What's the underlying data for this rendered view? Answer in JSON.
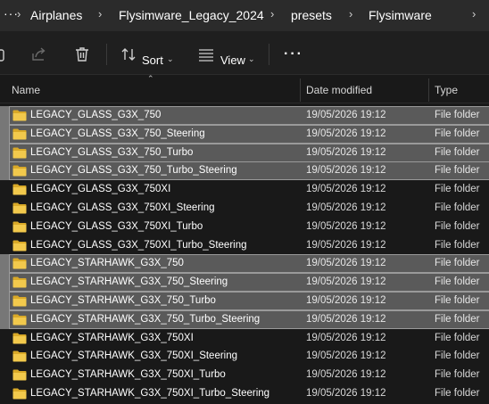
{
  "breadcrumb": {
    "overflow_label": "···",
    "items": [
      "Airplanes",
      "Flysimware_Legacy_2024",
      "presets",
      "Flysimware"
    ],
    "separator": "›"
  },
  "toolbar": {
    "sort_label": "Sort",
    "view_label": "View",
    "more_label": "···"
  },
  "columns": {
    "name": "Name",
    "date": "Date modified",
    "type": "Type"
  },
  "files": [
    {
      "name": "LEGACY_GLASS_G3X_750",
      "date": "19/05/2026 19:12",
      "type": "File folder",
      "selected": true
    },
    {
      "name": "LEGACY_GLASS_G3X_750_Steering",
      "date": "19/05/2026 19:12",
      "type": "File folder",
      "selected": true
    },
    {
      "name": "LEGACY_GLASS_G3X_750_Turbo",
      "date": "19/05/2026 19:12",
      "type": "File folder",
      "selected": true
    },
    {
      "name": "LEGACY_GLASS_G3X_750_Turbo_Steering",
      "date": "19/05/2026 19:12",
      "type": "File folder",
      "selected": true
    },
    {
      "name": "LEGACY_GLASS_G3X_750XI",
      "date": "19/05/2026 19:12",
      "type": "File folder",
      "selected": false
    },
    {
      "name": "LEGACY_GLASS_G3X_750XI_Steering",
      "date": "19/05/2026 19:12",
      "type": "File folder",
      "selected": false
    },
    {
      "name": "LEGACY_GLASS_G3X_750XI_Turbo",
      "date": "19/05/2026 19:12",
      "type": "File folder",
      "selected": false
    },
    {
      "name": "LEGACY_GLASS_G3X_750XI_Turbo_Steering",
      "date": "19/05/2026 19:12",
      "type": "File folder",
      "selected": false
    },
    {
      "name": "LEGACY_STARHAWK_G3X_750",
      "date": "19/05/2026 19:12",
      "type": "File folder",
      "selected": true
    },
    {
      "name": "LEGACY_STARHAWK_G3X_750_Steering",
      "date": "19/05/2026 19:12",
      "type": "File folder",
      "selected": true
    },
    {
      "name": "LEGACY_STARHAWK_G3X_750_Turbo",
      "date": "19/05/2026 19:12",
      "type": "File folder",
      "selected": true
    },
    {
      "name": "LEGACY_STARHAWK_G3X_750_Turbo_Steering",
      "date": "19/05/2026 19:12",
      "type": "File folder",
      "selected": true
    },
    {
      "name": "LEGACY_STARHAWK_G3X_750XI",
      "date": "19/05/2026 19:12",
      "type": "File folder",
      "selected": false
    },
    {
      "name": "LEGACY_STARHAWK_G3X_750XI_Steering",
      "date": "19/05/2026 19:12",
      "type": "File folder",
      "selected": false
    },
    {
      "name": "LEGACY_STARHAWK_G3X_750XI_Turbo",
      "date": "19/05/2026 19:12",
      "type": "File folder",
      "selected": false
    },
    {
      "name": "LEGACY_STARHAWK_G3X_750XI_Turbo_Steering",
      "date": "19/05/2026 19:12",
      "type": "File folder",
      "selected": false
    }
  ],
  "colors": {
    "folder": "#f2c94c",
    "folder_dark": "#d9a928",
    "selection": "#5a5a5a"
  },
  "icons": {
    "copy": "copy-icon",
    "share": "share-icon",
    "delete": "trash-icon",
    "sort": "sort-icon",
    "view": "view-list-icon",
    "folder": "folder-icon"
  }
}
